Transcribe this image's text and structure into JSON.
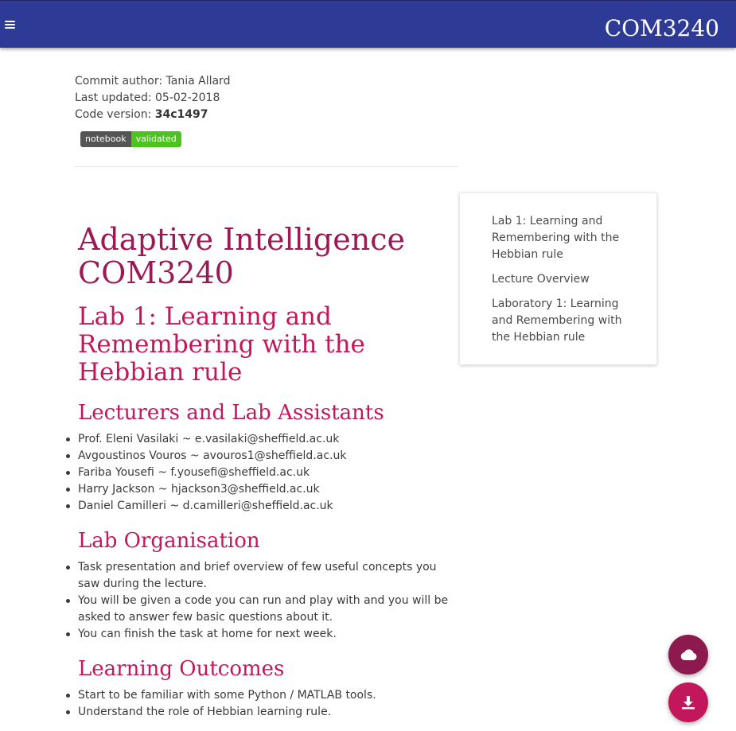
{
  "header": {
    "title": "COM3240"
  },
  "meta": {
    "commit_author_label": "Commit author: ",
    "commit_author": "Tania Allard",
    "last_updated_label": "Last updated: ",
    "last_updated": "05-02-2018",
    "code_version_label": "Code version: ",
    "code_version": "34c1497"
  },
  "badge": {
    "left": "notebook",
    "right": "validated",
    "left_color": "#555555",
    "right_color": "#4bc51d"
  },
  "toc": {
    "items": [
      {
        "label": "Lab 1: Learning and Remembering with the Hebbian rule"
      },
      {
        "label": "Lecture Overview"
      },
      {
        "label": "Laboratory 1: Learning and Remembering with the Hebbian rule"
      }
    ]
  },
  "content": {
    "title": "Adaptive Intelligence COM3240",
    "lab_title": "Lab 1: Learning and Remembering with the Hebbian rule",
    "sections": [
      {
        "heading": "Lecturers and Lab Assistants",
        "items": [
          "Prof. Eleni Vasilaki ~ e.vasilaki@sheffield.ac.uk",
          "Avgoustinos Vouros ~ avouros1@sheffield.ac.uk",
          "Fariba Yousefi ~ f.yousefi@sheffield.ac.uk",
          "Harry Jackson ~ hjackson3@sheffield.ac.uk",
          "Daniel Camilleri ~ d.camilleri@sheffield.ac.uk"
        ]
      },
      {
        "heading": "Lab Organisation",
        "items": [
          "Task presentation and brief overview of few useful concepts you saw during the lecture.",
          "You will be given a code you can run and play with and you will be asked to answer few basic questions about it.",
          "You can finish the task at home for next week."
        ]
      },
      {
        "heading": "Learning Outcomes",
        "items": [
          "Start to be familiar with some Python / MATLAB tools.",
          "Understand the role of Hebbian learning rule."
        ]
      }
    ]
  },
  "fabs": {
    "cloud_icon": "cloud-icon",
    "download_icon": "download-icon"
  },
  "colors": {
    "topbar": "#2d3a96",
    "heading": "#c2185b",
    "title": "#9a1a54"
  }
}
